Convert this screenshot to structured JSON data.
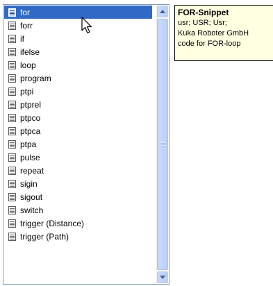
{
  "list": {
    "selected_index": 0,
    "items": [
      "for",
      "forr",
      "if",
      "ifelse",
      "loop",
      "program",
      "ptpi",
      "ptprel",
      "ptpco",
      "ptpca",
      "ptpa",
      "pulse",
      "repeat",
      "sigin",
      "sigout",
      "switch",
      "trigger (Distance)",
      "trigger (Path)"
    ],
    "item_icon": "snippet-document-icon"
  },
  "tooltip": {
    "title": "FOR-Snippet",
    "lines": [
      "usr; USR; Usr;",
      "Kuka Roboter GmbH",
      "code for FOR-loop"
    ]
  },
  "colors": {
    "selection": "#316ac5",
    "tooltip_bg": "#ffffe1",
    "scrollbar": "#c1d3fb"
  }
}
